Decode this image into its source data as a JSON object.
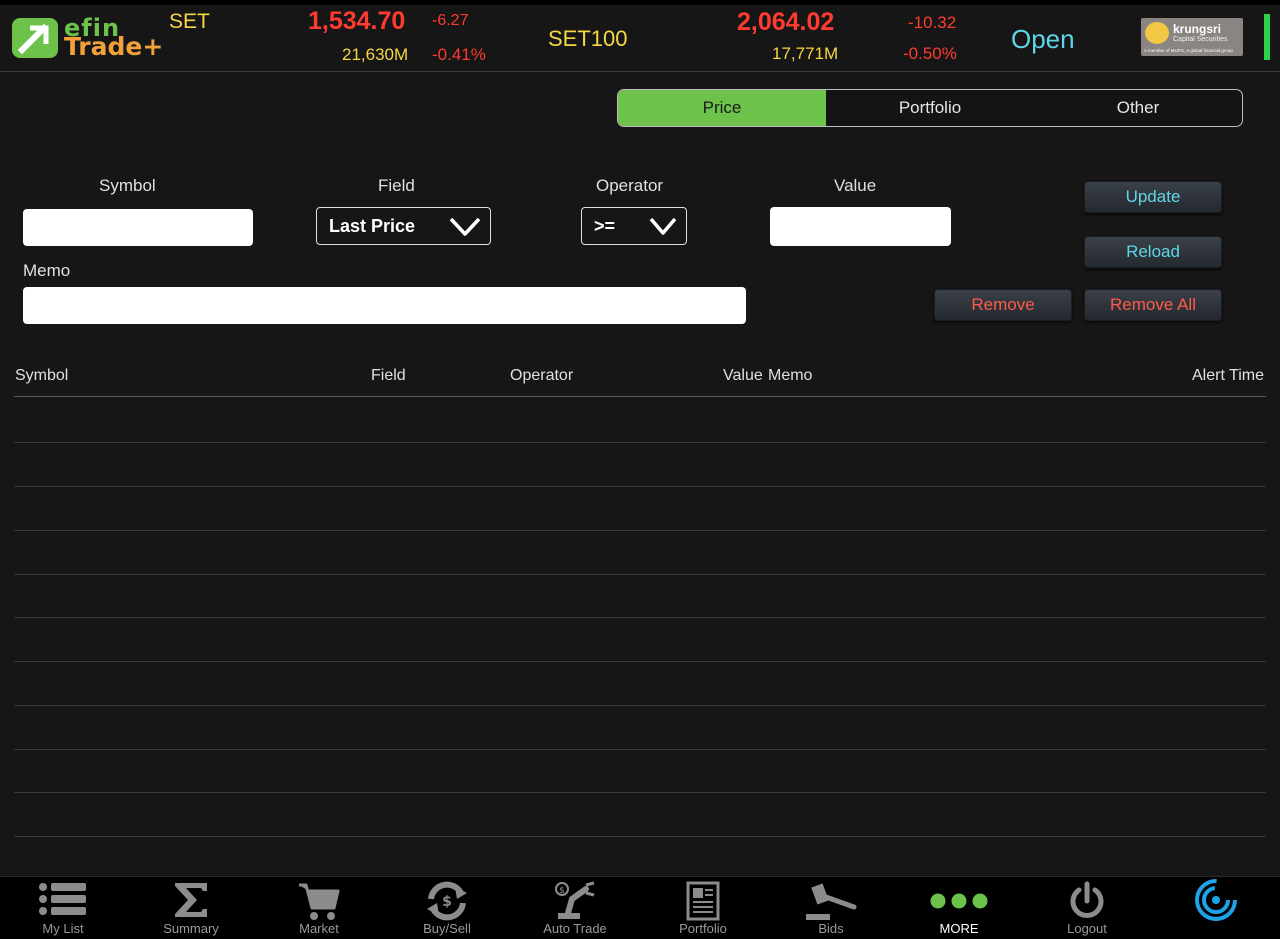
{
  "header": {
    "brand_top": "efin",
    "brand_bottom": "Trade+",
    "index1": {
      "name": "SET",
      "value": "1,534.70",
      "change": "-6.27",
      "volume": "21,630M",
      "percent": "-0.41%"
    },
    "index2": {
      "name": "SET100",
      "value": "2,064.02",
      "change": "-10.32",
      "volume": "17,771M",
      "percent": "-0.50%"
    },
    "market_status": "Open",
    "broker": {
      "name": "krungsri",
      "subtitle": "Capital Securities",
      "tagline": "A member of MUFG, a global financial group"
    },
    "colors": {
      "up_text": "#f6d743",
      "down_text": "#ff3b30",
      "status_text": "#5fd6e8",
      "connection_indicator": "#2bd14a"
    }
  },
  "tabs": [
    {
      "label": "Price",
      "active": true
    },
    {
      "label": "Portfolio",
      "active": false
    },
    {
      "label": "Other",
      "active": false
    }
  ],
  "form": {
    "symbol_label": "Symbol",
    "symbol_value": "",
    "field_label": "Field",
    "field_selected": "Last Price",
    "operator_label": "Operator",
    "operator_selected": ">=",
    "value_label": "Value",
    "value_value": "",
    "memo_label": "Memo",
    "memo_value": ""
  },
  "buttons": {
    "update": "Update",
    "reload": "Reload",
    "remove": "Remove",
    "remove_all": "Remove All"
  },
  "table": {
    "columns": [
      "Symbol",
      "Field",
      "Operator",
      "Value",
      "Memo",
      "Alert Time"
    ],
    "rows": []
  },
  "nav": {
    "items": [
      {
        "label": "My List",
        "icon": "list-icon"
      },
      {
        "label": "Summary",
        "icon": "sigma-icon"
      },
      {
        "label": "Market",
        "icon": "cart-icon"
      },
      {
        "label": "Buy/Sell",
        "icon": "exchange-icon"
      },
      {
        "label": "Auto Trade",
        "icon": "robot-arm-icon"
      },
      {
        "label": "Portfolio",
        "icon": "document-icon"
      },
      {
        "label": "Bids",
        "icon": "gavel-icon"
      },
      {
        "label": "MORE",
        "icon": "more-dots-icon",
        "active": true
      },
      {
        "label": "Logout",
        "icon": "power-icon"
      },
      {
        "label": "",
        "icon": "refresh-spinner-icon"
      }
    ],
    "accent": "#6cc24a"
  }
}
